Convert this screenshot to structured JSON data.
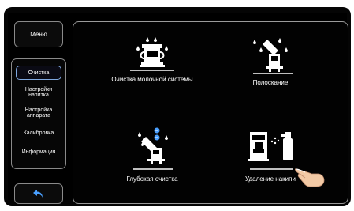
{
  "sidebar": {
    "menu_label": "Меню",
    "items": [
      {
        "label": "Очистка",
        "active": true
      },
      {
        "label": "Настройки напитка",
        "active": false
      },
      {
        "label": "Настройка аппарата",
        "active": false
      },
      {
        "label": "Калибровка",
        "active": false
      },
      {
        "label": "Информация",
        "active": false
      }
    ],
    "back_icon": "return-arrow-icon"
  },
  "tiles": [
    {
      "label": "Очистка молочной системы",
      "icon": "milk-system-cleaning-icon"
    },
    {
      "label": "Полоскание",
      "icon": "rinse-icon"
    },
    {
      "label": "Глубокая очистка",
      "icon": "deep-cleaning-icon"
    },
    {
      "label": "Удаление накипи",
      "icon": "descaling-icon"
    }
  ],
  "colors": {
    "accent": "#7fa8e0",
    "background": "#000000",
    "text": "#ffffff",
    "border": "#8a8a8a"
  }
}
